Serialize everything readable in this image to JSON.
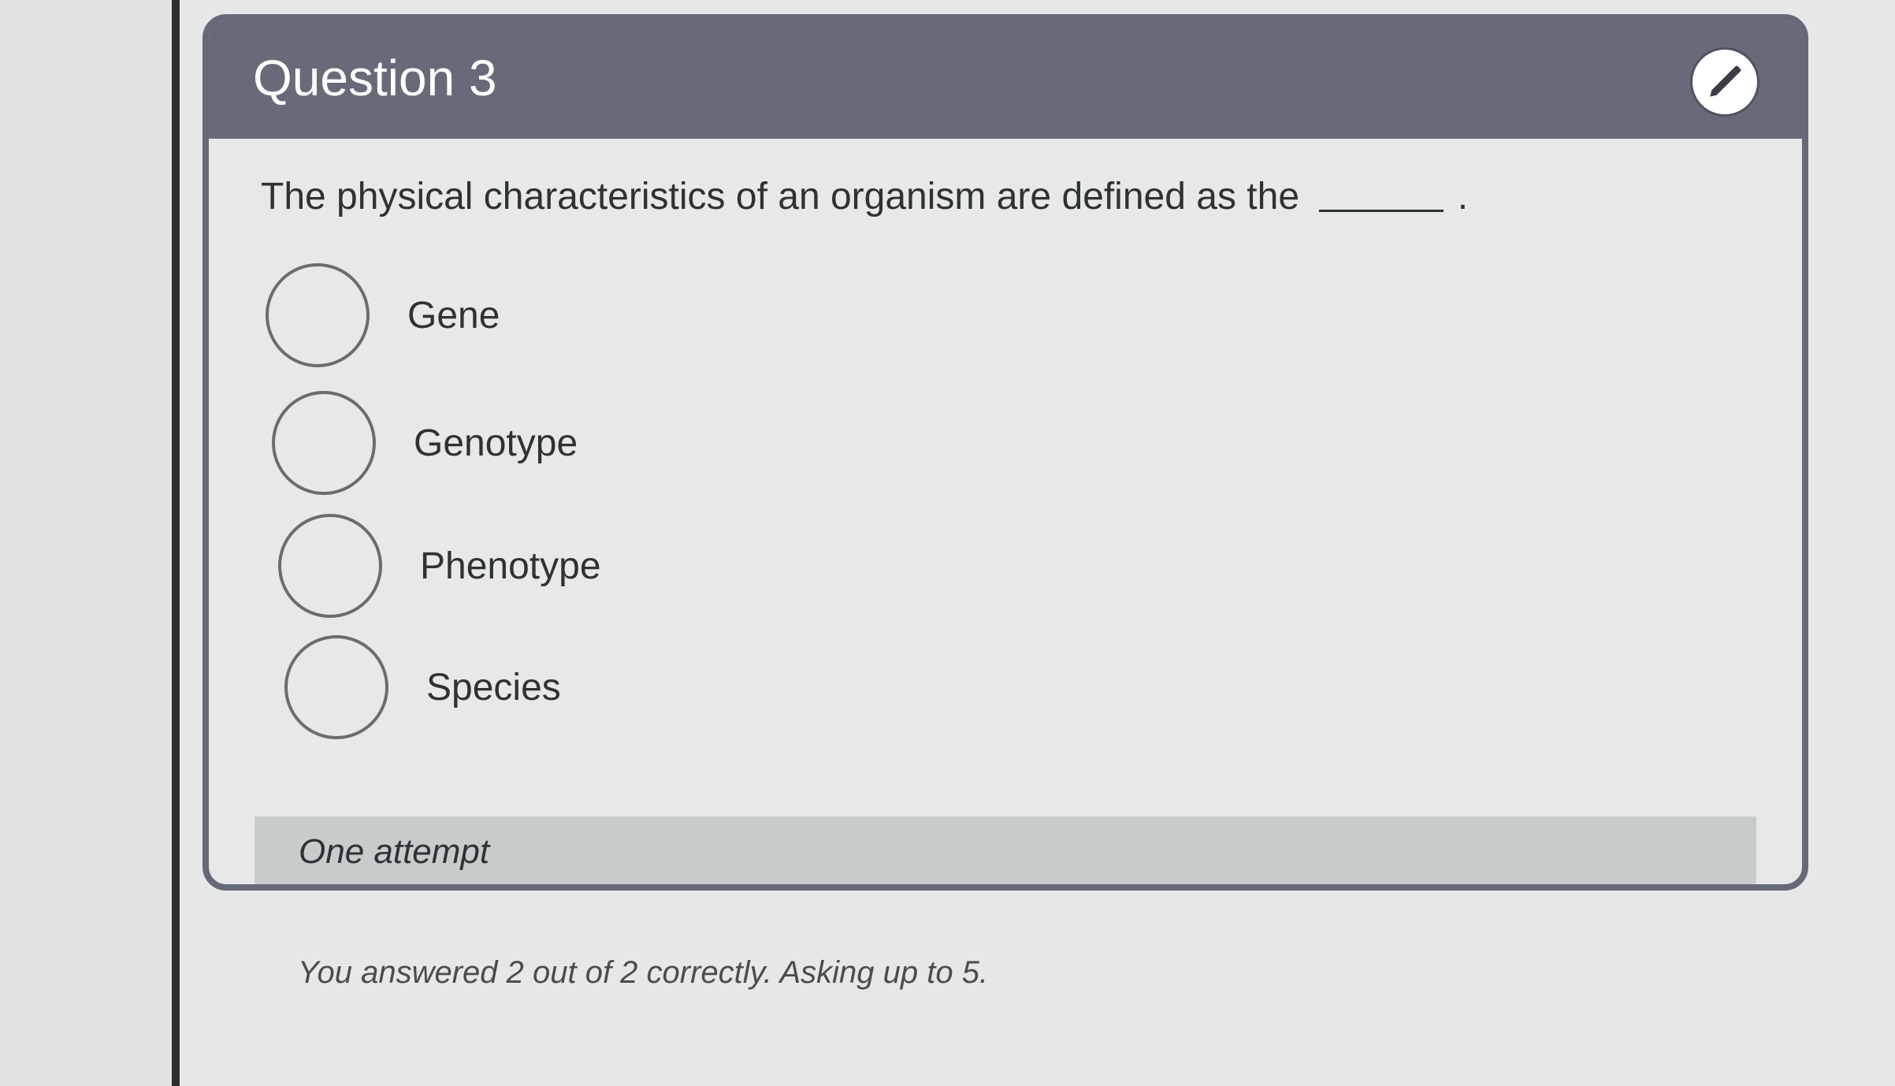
{
  "question": {
    "title": "Question 3",
    "text": "The physical characteristics of an organism are defined as the",
    "blank_suffix": "."
  },
  "options": [
    {
      "label": "Gene"
    },
    {
      "label": "Genotype"
    },
    {
      "label": "Phenotype"
    },
    {
      "label": "Species"
    }
  ],
  "attempt": {
    "text": "One attempt"
  },
  "footer": {
    "text": "You answered 2 out of 2 correctly. Asking up to 5."
  },
  "icons": {
    "edit": "pencil-icon"
  },
  "colors": {
    "header": "#676b79",
    "card_border": "#656a78",
    "background": "#e6e9e8",
    "attempt_bar": "#c8cbcb"
  }
}
